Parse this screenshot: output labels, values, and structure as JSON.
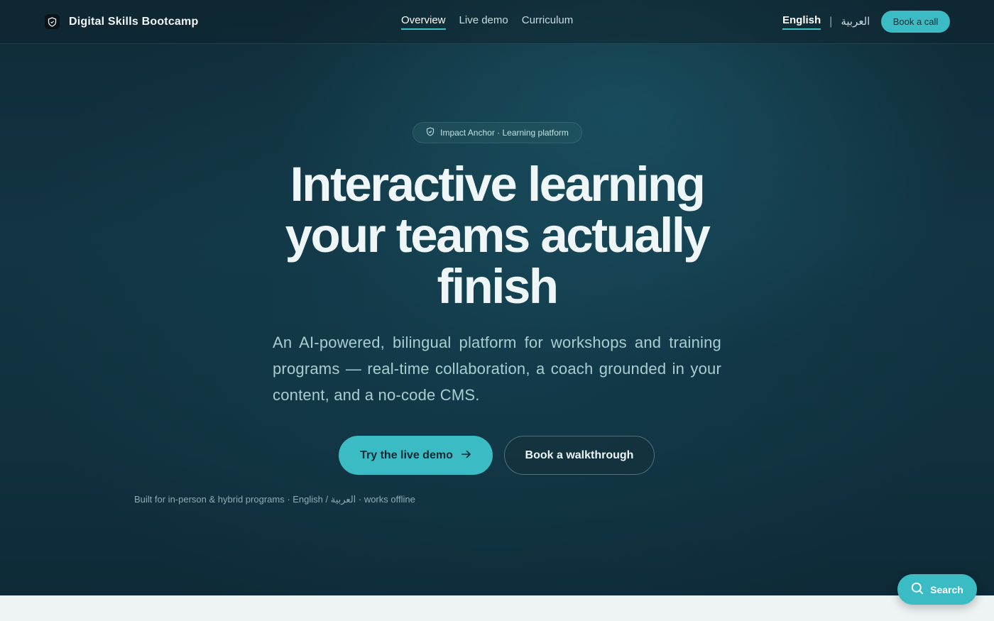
{
  "brand": {
    "name": "Digital Skills Bootcamp",
    "logo_icon": "shield-icon"
  },
  "nav": {
    "items": [
      {
        "label": "Overview",
        "active": true
      },
      {
        "label": "Live demo",
        "active": false
      },
      {
        "label": "Curriculum",
        "active": false
      }
    ]
  },
  "language": {
    "english": "English",
    "separator": "|",
    "arabic": "العربية",
    "active": "English"
  },
  "header": {
    "cta_label": "Book a call"
  },
  "hero": {
    "badge_icon": "shield-check-icon",
    "badge": "Impact Anchor · Learning platform",
    "headline": "Interactive learning your teams actually finish",
    "subtext": "An AI-powered, bilingual platform for workshops and training programs — real-time collaboration, a coach grounded in your content, and a no-code CMS.",
    "primary_cta": "Try the live demo",
    "primary_cta_icon": "arrow-right-icon",
    "secondary_cta": "Book a walkthrough",
    "footnote": "Built for in-person & hybrid programs · English / العربية · works offline"
  },
  "search": {
    "label": "Search",
    "icon": "search-icon"
  },
  "colors": {
    "accent": "#3bbcc5",
    "hero_bg": "#123444",
    "page_bg": "#eef3f4"
  }
}
